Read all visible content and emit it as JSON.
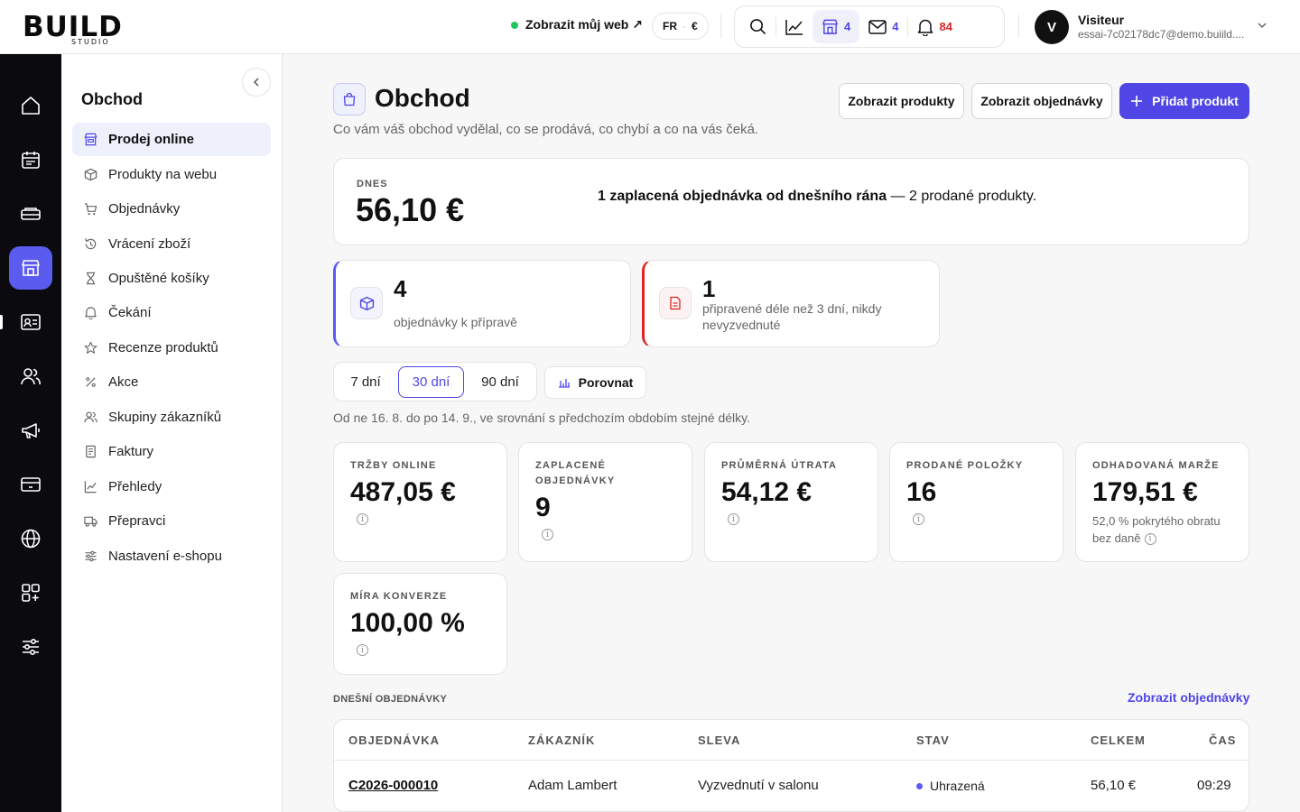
{
  "brand": {
    "logo_text": "BUILD",
    "logo_sub": "STUDIO"
  },
  "header": {
    "view_site": "Zobrazit můj web ↗",
    "lang": "FR",
    "currency": "€",
    "shop_count": "4",
    "mail_count": "4",
    "notif_count": "84",
    "user_initial": "V",
    "user_name": "Visiteur",
    "user_email": "essai-7c02178dc7@demo.buiild...."
  },
  "rail": {
    "icons": [
      "home-icon",
      "calendar-icon",
      "services-icon",
      "store-icon",
      "contact-card-icon",
      "users-icon",
      "megaphone-icon",
      "payment-card-icon",
      "globe-icon",
      "apps-icon",
      "sliders-icon"
    ],
    "active_index": 3
  },
  "sidebar": {
    "title": "Obchod",
    "items": [
      {
        "label": "Prodej online",
        "icon": "storefront-icon"
      },
      {
        "label": "Produkty na webu",
        "icon": "box-icon"
      },
      {
        "label": "Objednávky",
        "icon": "cart-icon"
      },
      {
        "label": "Vrácení zboží",
        "icon": "history-icon"
      },
      {
        "label": "Opuštěné košíky",
        "icon": "hourglass-icon"
      },
      {
        "label": "Čekání",
        "icon": "bell-icon"
      },
      {
        "label": "Recenze produktů",
        "icon": "star-icon"
      },
      {
        "label": "Akce",
        "icon": "percent-icon"
      },
      {
        "label": "Skupiny zákazníků",
        "icon": "users-icon"
      },
      {
        "label": "Faktury",
        "icon": "invoice-icon"
      },
      {
        "label": "Přehledy",
        "icon": "chart-icon"
      },
      {
        "label": "Přepravci",
        "icon": "truck-icon"
      },
      {
        "label": "Nastavení e-shopu",
        "icon": "settings-icon"
      }
    ]
  },
  "page": {
    "title": "Obchod",
    "subtitle": "Co vám váš obchod vydělal, co se prodává, co chybí a co na vás čeká.",
    "btn_products": "Zobrazit produkty",
    "btn_orders": "Zobrazit objednávky",
    "btn_add": "Přidat produkt"
  },
  "today": {
    "label": "DNES",
    "value": "56,10 €",
    "msg_bold": "1 zaplacená objednávka od dnešního rána",
    "msg_rest": " — 2 prodané produkty."
  },
  "alerts": [
    {
      "number": "4",
      "text": "objednávky k přípravě"
    },
    {
      "number": "1",
      "text": "připravené déle než 3 dní, nikdy nevyzvednuté"
    }
  ],
  "periods": {
    "options": [
      "7 dní",
      "30 dní",
      "90 dní"
    ],
    "selected": "30 dní",
    "compare": "Porovnat"
  },
  "range_text": "Od ne 16. 8. do po 14. 9., ve srovnání s předchozím obdobím stejné délky.",
  "kpis": [
    {
      "label": "TRŽBY ONLINE",
      "value": "487,05 €"
    },
    {
      "label": "ZAPLACENÉ OBJEDNÁVKY",
      "value": "9"
    },
    {
      "label": "PRŮMĚRNÁ ÚTRATA",
      "value": "54,12 €"
    },
    {
      "label": "PRODANÉ POLOŽKY",
      "value": "16"
    },
    {
      "label": "ODHADOVANÁ MARŽE",
      "value": "179,51 €",
      "note": "52,0 % pokrytého obratu bez daně"
    },
    {
      "label": "MÍRA KONVERZE",
      "value": "100,00 %"
    }
  ],
  "orders_section": {
    "title": "DNEŠNÍ OBJEDNÁVKY",
    "link": "Zobrazit objednávky",
    "columns": [
      "OBJEDNÁVKA",
      "ZÁKAZNÍK",
      "SLEVA",
      "STAV",
      "CELKEM",
      "ČAS"
    ],
    "rows": [
      {
        "order": "C2026-000010",
        "customer": "Adam Lambert",
        "discount": "Vyzvednutí v salonu",
        "status": "Uhrazená",
        "total": "56,10 €",
        "time": "09:29"
      }
    ]
  }
}
